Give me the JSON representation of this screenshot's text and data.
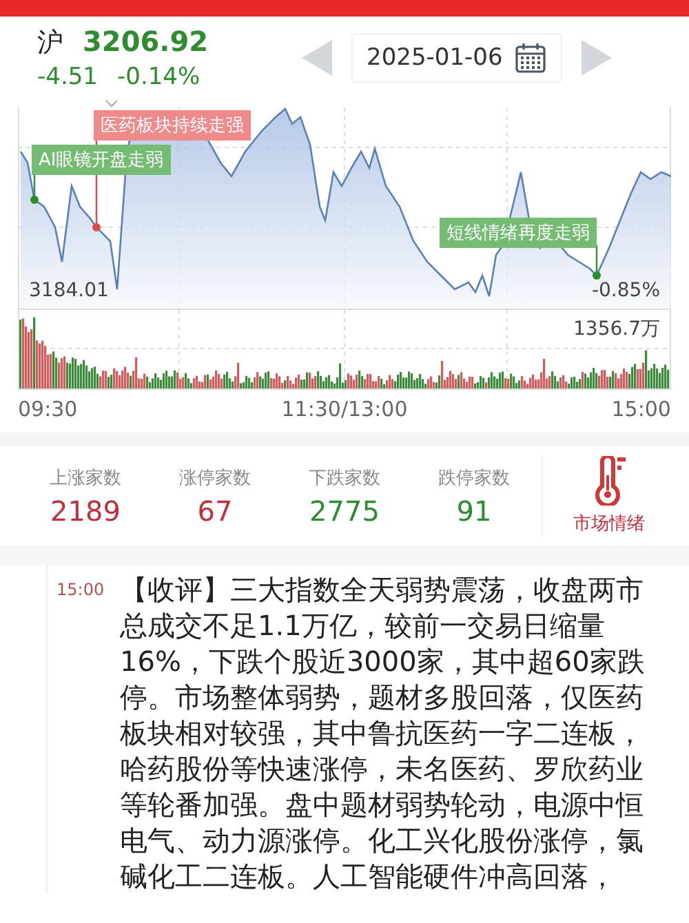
{
  "quote": {
    "market": "沪",
    "price": "3206.92",
    "change": "-4.51",
    "change_pct": "-0.14%",
    "kind": "down"
  },
  "date_picker": {
    "date": "2025-01-06"
  },
  "chart": {
    "low_label": "3184.01",
    "end_pct": "-0.85%",
    "volume_max": "1356.7万",
    "annotations": [
      {
        "text": "医药板块持续走强",
        "kind": "up"
      },
      {
        "text": "AI眼镜开盘走弱",
        "kind": "down"
      },
      {
        "text": "短线情绪再度走弱",
        "kind": "down"
      }
    ],
    "time_labels": [
      "09:30",
      "11:30/13:00",
      "15:00"
    ]
  },
  "stats": [
    {
      "label": "上涨家数",
      "value": "2189",
      "kind": "up"
    },
    {
      "label": "涨停家数",
      "value": "67",
      "kind": "up"
    },
    {
      "label": "下跌家数",
      "value": "2775",
      "kind": "down"
    },
    {
      "label": "跌停家数",
      "value": "91",
      "kind": "down"
    }
  ],
  "sentiment_button": {
    "label": "市场情绪"
  },
  "news": [
    {
      "time": "15:00",
      "text": "【收评】三大指数全天弱势震荡，收盘两市总成交不足1.1万亿，较前一交易日缩量16%，下跌个股近3000家，其中超60家跌停。市场整体弱势，题材多股回落，仅医药板块相对较强，其中鲁抗医药一字二连板，哈药股份等快速涨停，未名医药、罗欣药业等轮番加强。盘中题材弱势轮动，电源中恒电气、动力源涨停。化工兴化股份涨停，氯碱化工二连板。人工智能硬件冲高回落，"
    }
  ]
}
